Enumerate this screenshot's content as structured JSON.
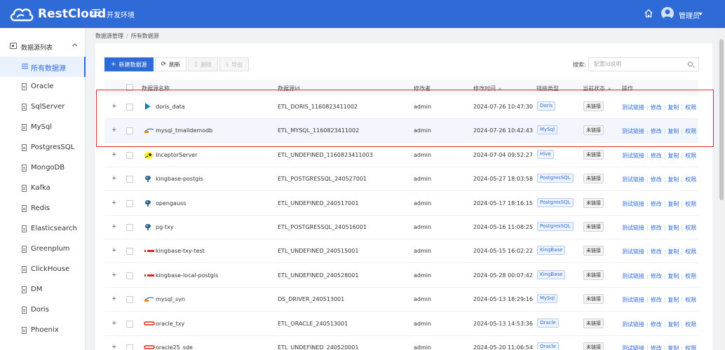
{
  "header": {
    "brand": "RestCloud",
    "env_title": "开发环境",
    "user_name": "管理员",
    "brand_color": "#2f6bd6"
  },
  "sidebar": {
    "group_label": "数据源列表",
    "items": [
      {
        "label": "所有数据源",
        "active": true
      },
      {
        "label": "Oracle"
      },
      {
        "label": "SqlServer"
      },
      {
        "label": "MySql"
      },
      {
        "label": "PostgresSQL"
      },
      {
        "label": "MongoDB"
      },
      {
        "label": "Kafka"
      },
      {
        "label": "Redis"
      },
      {
        "label": "Elasticsearch"
      },
      {
        "label": "Greenplum"
      },
      {
        "label": "ClickHouse"
      },
      {
        "label": "DM"
      },
      {
        "label": "Doris"
      },
      {
        "label": "Phoenix"
      }
    ]
  },
  "breadcrumb": {
    "parent": "数据源管理",
    "separator": "/",
    "current": "所有数据源"
  },
  "toolbar": {
    "new_label": "新建数据源",
    "refresh_label": "刷新",
    "delete_label": "删除",
    "export_label": "导出",
    "search_label": "搜索:",
    "search_placeholder": "配置Id说明"
  },
  "table": {
    "headers": {
      "name": "数据源名称",
      "id": "数据源Id",
      "modifier": "修改者",
      "modified_time": "修改时间",
      "link_type": "链接类型",
      "status": "当前状态",
      "actions": "操作"
    },
    "actions": {
      "test": "测试链接",
      "edit": "修改",
      "copy": "复制",
      "permission": "权限"
    },
    "rows": [
      {
        "name": "doris_data",
        "id": "ETL_DORIS_1160823411002",
        "modifier": "admin",
        "time": "2024-07-26 10:47:30",
        "type": "Doris",
        "status": "未链接",
        "icon": "doris-icon"
      },
      {
        "name": "mysql_tmalldemodb",
        "id": "ETL_MYSQL_1160823411002",
        "modifier": "admin",
        "time": "2024-07-26 10:42:43",
        "type": "MySql",
        "status": "未链接",
        "icon": "mysql-icon"
      },
      {
        "name": "InceptorServer",
        "id": "ETL_UNDEFINED_1160823411003",
        "modifier": "admin",
        "time": "2024-07-04 09:52:27",
        "type": "Hive",
        "status": "未链接",
        "icon": "hive-icon"
      },
      {
        "name": "kingbase-postgis",
        "id": "ETL_POSTGRESSQL_240527001",
        "modifier": "admin",
        "time": "2024-05-27 18:03:58",
        "type": "PostgresSQL",
        "status": "未链接",
        "icon": "postgres-icon"
      },
      {
        "name": "opengauss",
        "id": "ETL_UNDEFINED_240517001",
        "modifier": "admin",
        "time": "2024-05-17 18:16:15",
        "type": "PostgresSQL",
        "status": "未链接",
        "icon": "postgres-icon"
      },
      {
        "name": "pg-txy",
        "id": "ETL_POSTGRESSQL_240516001",
        "modifier": "admin",
        "time": "2024-05-16 11:08:25",
        "type": "PostgresSQL",
        "status": "未链接",
        "icon": "postgres-icon"
      },
      {
        "name": "kingbase-txy-test",
        "id": "ETL_UNDEFINED_240515001",
        "modifier": "admin",
        "time": "2024-05-15 16:02:22",
        "type": "KingBase",
        "status": "未链接",
        "icon": "kingbase-icon"
      },
      {
        "name": "kingbase-local-postgis",
        "id": "ETL_UNDEFINED_240528001",
        "modifier": "admin",
        "time": "2024-05-28 00:07:42",
        "type": "KingBase",
        "status": "未链接",
        "icon": "kingbase-icon"
      },
      {
        "name": "mysql_syn",
        "id": "DS_DRIVER_240513001",
        "modifier": "admin",
        "time": "2024-05-13 18:29:16",
        "type": "MySql",
        "status": "未链接",
        "icon": "mysql-icon"
      },
      {
        "name": "oracle_txy",
        "id": "ETL_ORACLE_240513001",
        "modifier": "admin",
        "time": "2024-05-13 14:53:36",
        "type": "Oracle",
        "status": "未链接",
        "icon": "oracle-icon"
      },
      {
        "name": "oracle25_sde",
        "id": "ETL_UNDEFINED_240520001",
        "modifier": "admin",
        "time": "2024-05-20 11:06:54",
        "type": "Oracle",
        "status": "未链接",
        "icon": "oracle-icon"
      }
    ]
  }
}
